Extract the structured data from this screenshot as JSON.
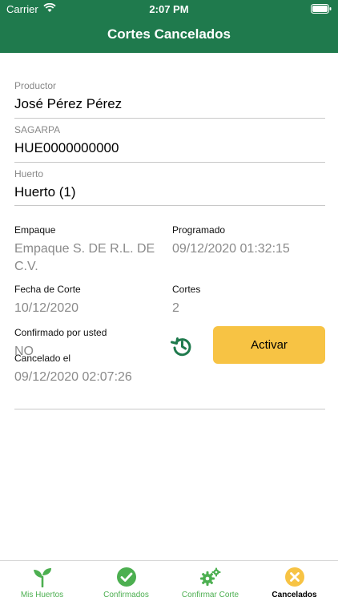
{
  "status_bar": {
    "carrier": "Carrier",
    "time": "2:07 PM"
  },
  "header": {
    "title": "Cortes Cancelados"
  },
  "fields": {
    "productor": {
      "label": "Productor",
      "value": "José Pérez Pérez"
    },
    "sagarpa": {
      "label": "SAGARPA",
      "value": "HUE0000000000"
    },
    "huerto": {
      "label": "Huerto",
      "value": "Huerto (1)"
    }
  },
  "details": {
    "empaque": {
      "label": "Empaque",
      "value": "Empaque S. DE R.L. DE C.V."
    },
    "programado": {
      "label": "Programado",
      "value": "09/12/2020 01:32:15"
    },
    "fecha_corte": {
      "label": "Fecha de Corte",
      "value": "10/12/2020"
    },
    "cortes": {
      "label": "Cortes",
      "value": "2"
    },
    "confirmado": {
      "label": "Confirmado por usted",
      "value": "NO"
    },
    "cancelado": {
      "label": "Cancelado el",
      "value": "09/12/2020 02:07:26"
    }
  },
  "actions": {
    "activate_label": "Activar"
  },
  "tabs": [
    {
      "label": "Mis Huertos",
      "icon": "sprout-icon"
    },
    {
      "label": "Confirmados",
      "icon": "check-circle-icon"
    },
    {
      "label": "Confirmar Corte",
      "icon": "gears-icon"
    },
    {
      "label": "Cancelados",
      "icon": "x-circle-icon"
    }
  ],
  "colors": {
    "primary": "#1f7a4d",
    "accent": "#f7c344",
    "inactive_tab": "#4caf50"
  }
}
